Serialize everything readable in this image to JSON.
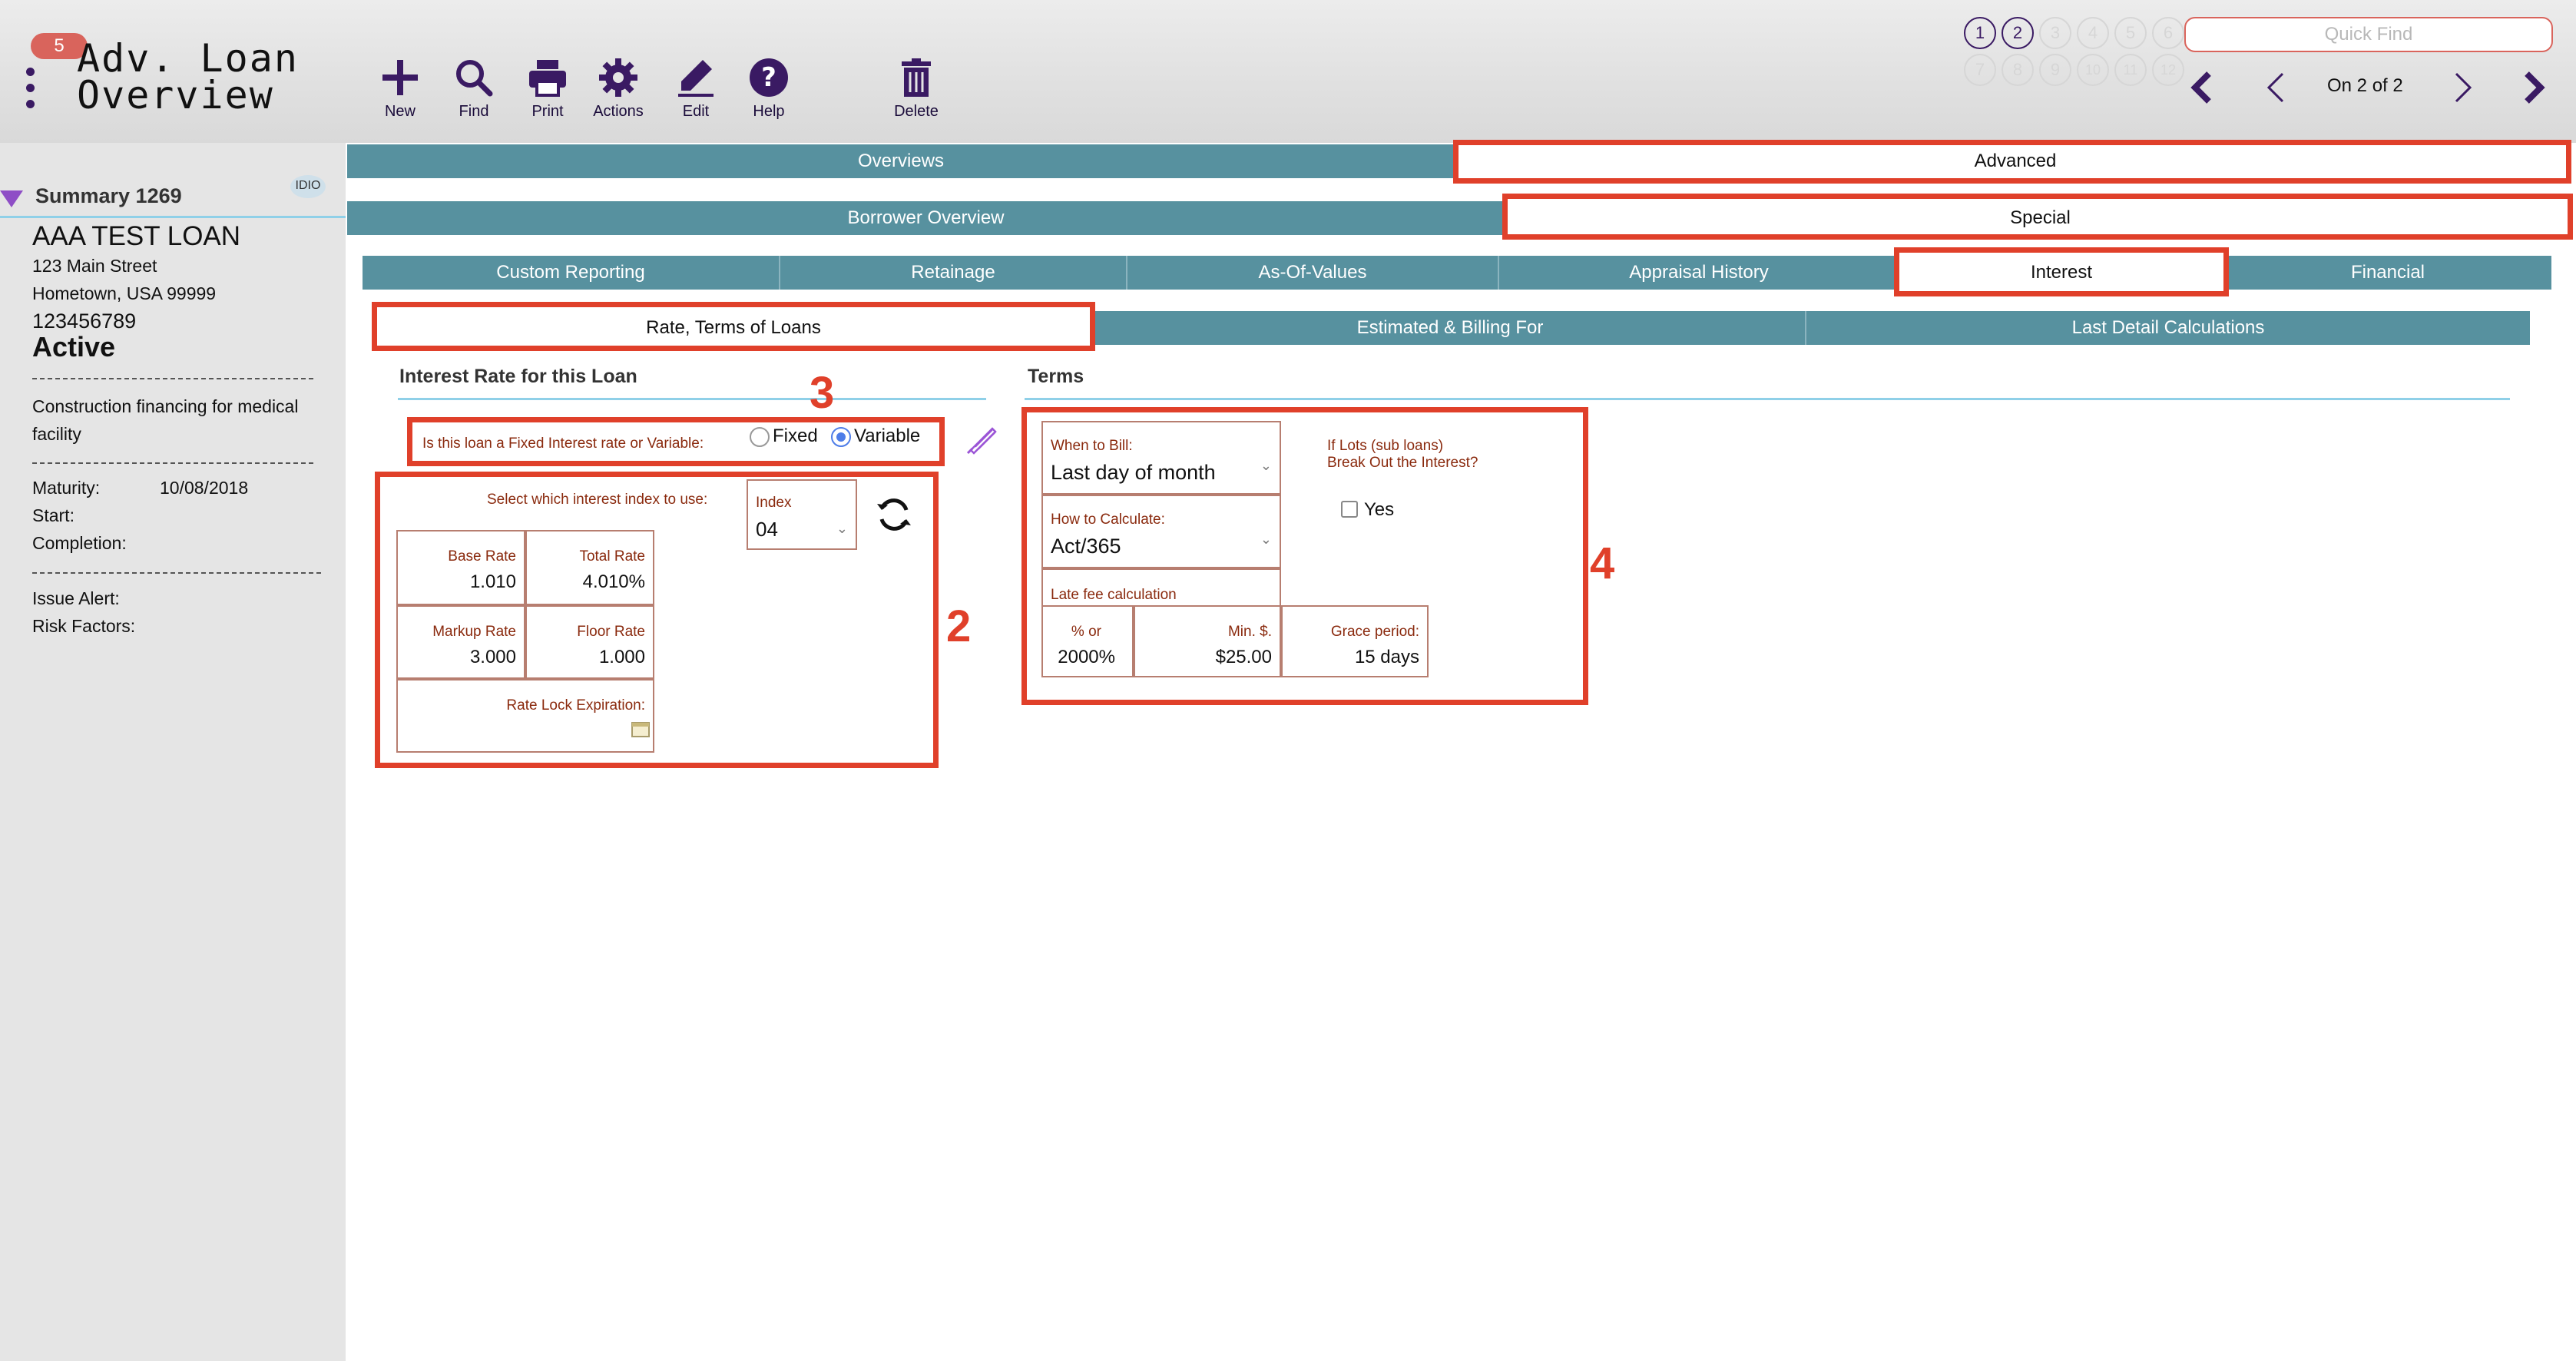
{
  "header": {
    "badge_count": "5",
    "title_line1": "Adv. Loan",
    "title_line2": "Overview",
    "toolbar": {
      "new": "New",
      "find": "Find",
      "print": "Print",
      "actions": "Actions",
      "edit": "Edit",
      "help": "Help",
      "delete": "Delete"
    },
    "pages_row1": [
      "1",
      "2",
      "3",
      "4",
      "5",
      "6"
    ],
    "pages_row2": [
      "7",
      "8",
      "9",
      "10",
      "11",
      "12"
    ],
    "quick_find_placeholder": "Quick Find",
    "record_position": "On 2 of 2"
  },
  "sidebar": {
    "summary_label": "Summary 1269",
    "idio_label": "IDIO",
    "loan_name": "AAA TEST LOAN",
    "address_line1": "123 Main Street",
    "address_line2": "Hometown, USA  99999",
    "loan_number": "123456789",
    "status": "Active",
    "description": "Construction financing for medical facility",
    "maturity_label": "Maturity:",
    "maturity_value": "10/08/2018",
    "start_label": "Start:",
    "completion_label": "Completion:",
    "issue_alert_label": "Issue Alert:",
    "risk_factors_label": "Risk Factors:"
  },
  "tabs": {
    "row1": [
      "Overviews",
      "Advanced"
    ],
    "row2": [
      "Borrower Overview",
      "Special"
    ],
    "row3": [
      "Custom Reporting",
      "Retainage",
      "As-Of-Values",
      "Appraisal History",
      "Interest",
      "Financial"
    ],
    "row4": [
      "Rate, Terms of Loans",
      "Estimated & Billing For",
      "Last Detail Calculations"
    ]
  },
  "interest": {
    "section_title": "Interest Rate for this Loan",
    "question": "Is this loan a Fixed Interest rate or Variable:",
    "option_fixed": "Fixed",
    "option_variable": "Variable",
    "selected": "Variable",
    "select_index_label": "Select which interest index to use:",
    "index_label": "Index",
    "index_value": "04",
    "base_rate_label": "Base Rate",
    "base_rate_value": "1.010",
    "total_rate_label": "Total Rate",
    "total_rate_value": "4.010%",
    "markup_rate_label": "Markup Rate",
    "markup_rate_value": "3.000",
    "floor_rate_label": "Floor Rate",
    "floor_rate_value": "1.000",
    "rate_lock_label": "Rate Lock Expiration:"
  },
  "terms": {
    "section_title": "Terms",
    "when_to_bill_label": "When to Bill:",
    "when_to_bill_value": "Last day of month",
    "how_to_calc_label": "How to Calculate:",
    "how_to_calc_value": "Act/365",
    "late_fee_label": "Late fee calculation",
    "pct_label": "% or",
    "pct_value": "2000%",
    "min_label": "Min. $.",
    "min_value": "$25.00",
    "grace_label": "Grace period:",
    "grace_value": "15 days",
    "lots_label_line1": "If Lots (sub loans)",
    "lots_label_line2": "Break Out the Interest?",
    "yes_label": "Yes"
  },
  "annotations": [
    "2",
    "3",
    "4"
  ],
  "colors": {
    "tab_bg": "#57919f",
    "highlight": "#e0402a",
    "accent_purple": "#3a1a63",
    "label_brown": "#8a2a0e"
  }
}
